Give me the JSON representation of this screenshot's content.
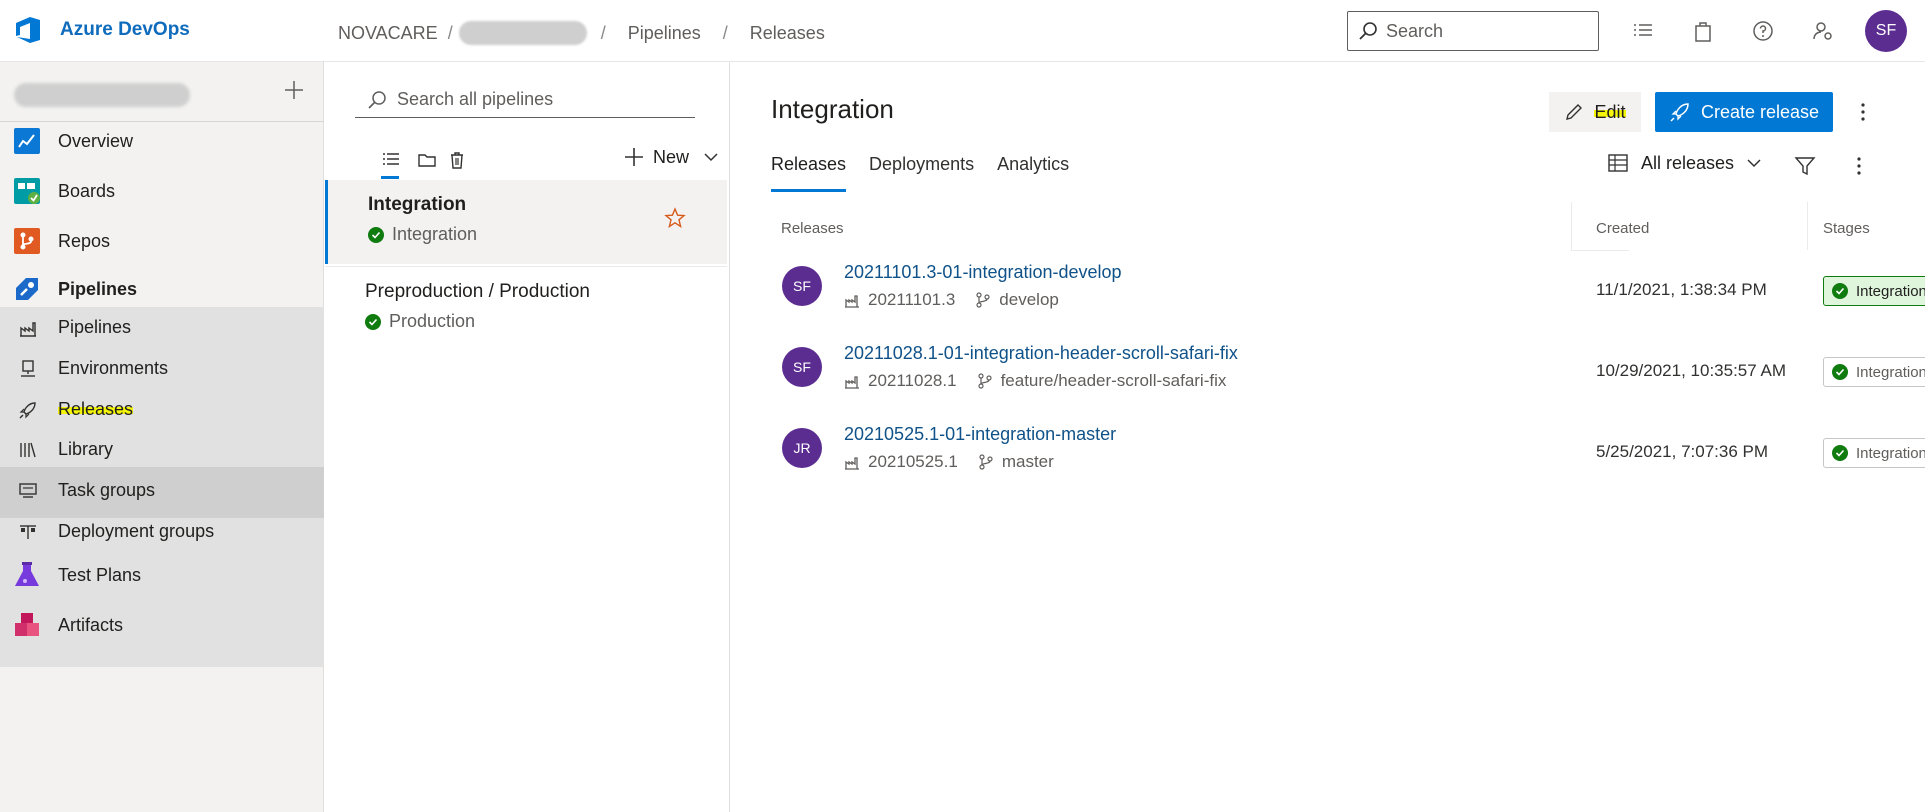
{
  "app": {
    "brand": "Azure DevOps"
  },
  "breadcrumb": {
    "org": "NOVACARE",
    "sep": "/",
    "items": [
      "Pipelines",
      "Releases"
    ]
  },
  "header": {
    "search_placeholder": "Search",
    "user_initials": "SF"
  },
  "nav": {
    "items": [
      {
        "label": "Overview"
      },
      {
        "label": "Boards"
      },
      {
        "label": "Repos"
      },
      {
        "label": "Pipelines"
      },
      {
        "label": "Pipelines"
      },
      {
        "label": "Environments"
      },
      {
        "label": "Releases"
      },
      {
        "label": "Library"
      },
      {
        "label": "Task groups"
      },
      {
        "label": "Deployment groups"
      },
      {
        "label": "Test Plans"
      },
      {
        "label": "Artifacts"
      }
    ]
  },
  "pipelines_panel": {
    "search_placeholder": "Search all pipelines",
    "new_label": "New",
    "items": [
      {
        "title": "Integration",
        "subtitle": "Integration",
        "selected": true
      },
      {
        "title": "Preproduction / Production",
        "subtitle": "Production",
        "selected": false
      }
    ]
  },
  "main": {
    "title": "Integration",
    "edit_label": "Edit",
    "create_label": "Create release",
    "tabs": [
      "Releases",
      "Deployments",
      "Analytics"
    ],
    "filter_label": "All releases",
    "columns": {
      "releases": "Releases",
      "created": "Created",
      "stages": "Stages"
    },
    "releases": [
      {
        "initials": "SF",
        "name": "20211101.3-01-integration-develop",
        "build": "20211101.3",
        "branch": "develop",
        "created": "11/1/2021, 1:38:34 PM",
        "stage": "Integration"
      },
      {
        "initials": "SF",
        "name": "20211028.1-01-integration-header-scroll-safari-fix",
        "build": "20211028.1",
        "branch": "feature/header-scroll-safari-fix",
        "created": "10/29/2021, 10:35:57 AM",
        "stage": "Integration"
      },
      {
        "initials": "JR",
        "name": "20210525.1-01-integration-master",
        "build": "20210525.1",
        "branch": "master",
        "created": "5/25/2021, 7:07:36 PM",
        "stage": "Integration"
      }
    ]
  },
  "colors": {
    "accent": "#0078d4",
    "avatar": "#5c2d91",
    "success": "#107c10",
    "highlight": "#f5f50a"
  }
}
